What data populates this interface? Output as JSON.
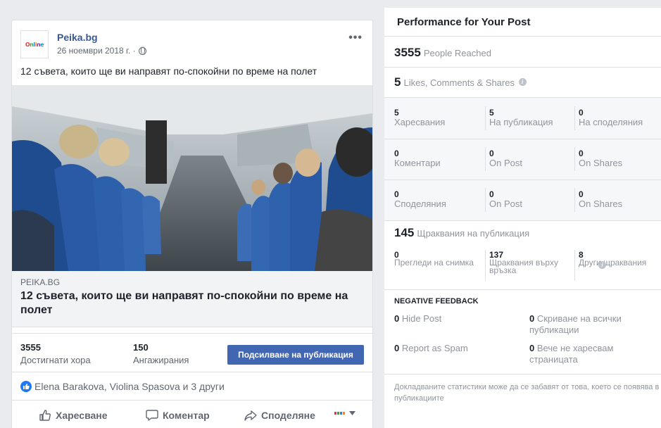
{
  "post": {
    "page_name": "Peika.bg",
    "avatar_text": "Peika.bg",
    "date": "26 ноември 2018 г. ·",
    "text": "12 съвета, които ще ви направят по-спокойни по време на полет",
    "link_domain": "PEIKA.BG",
    "link_title": "12 съвета, които ще ви направят по-спокойни по време на полет",
    "reach_value": "3555",
    "reach_label": "Достигнати хора",
    "engagement_value": "150",
    "engagement_label": "Ангажирания",
    "boost_label": "Подсилване на публикация",
    "reactors": "Elena Barakova, Violina Spasova и 3 други",
    "actions": {
      "like": "Харесване",
      "comment": "Коментар",
      "share": "Споделяне"
    }
  },
  "performance": {
    "title": "Performance for Your Post",
    "people_reached_value": "3555",
    "people_reached_label": "People Reached",
    "engagement_value": "5",
    "engagement_label": "Likes, Comments & Shares",
    "rows": [
      [
        {
          "value": "5",
          "label": "Харесвания"
        },
        {
          "value": "5",
          "label": "На публикация"
        },
        {
          "value": "0",
          "label": "На споделяния"
        }
      ],
      [
        {
          "value": "0",
          "label": "Коментари"
        },
        {
          "value": "0",
          "label": "On Post"
        },
        {
          "value": "0",
          "label": "On Shares"
        }
      ],
      [
        {
          "value": "0",
          "label": "Споделяния"
        },
        {
          "value": "0",
          "label": "On Post"
        },
        {
          "value": "0",
          "label": "On Shares"
        }
      ]
    ],
    "clicks_value": "145",
    "clicks_label": "Щраквания на публикация",
    "clicks": [
      {
        "value": "0",
        "label": "Прегледи на снимка"
      },
      {
        "value": "137",
        "label": "Щраквания върху връзка"
      },
      {
        "value": "8",
        "label": "Други щраквания"
      }
    ],
    "negative_title": "NEGATIVE FEEDBACK",
    "negative": [
      {
        "value": "0",
        "label": "Hide Post"
      },
      {
        "value": "0",
        "label": "Скриване на всички публикации"
      },
      {
        "value": "0",
        "label": "Report as Spam"
      },
      {
        "value": "0",
        "label": "Вече не харесвам страницата"
      }
    ],
    "footnote": "Докладваните статистики може да се забавят от това, което се появява в публикациите"
  },
  "colors": {
    "accent": "#4267b2",
    "link": "#385898",
    "like_blue": "#2078f4",
    "page_bg": "#e9ebee"
  },
  "icons": [
    "globe-icon",
    "more-icon",
    "like-icon",
    "comment-icon",
    "share-icon",
    "info-icon",
    "chevron-down-icon"
  ]
}
